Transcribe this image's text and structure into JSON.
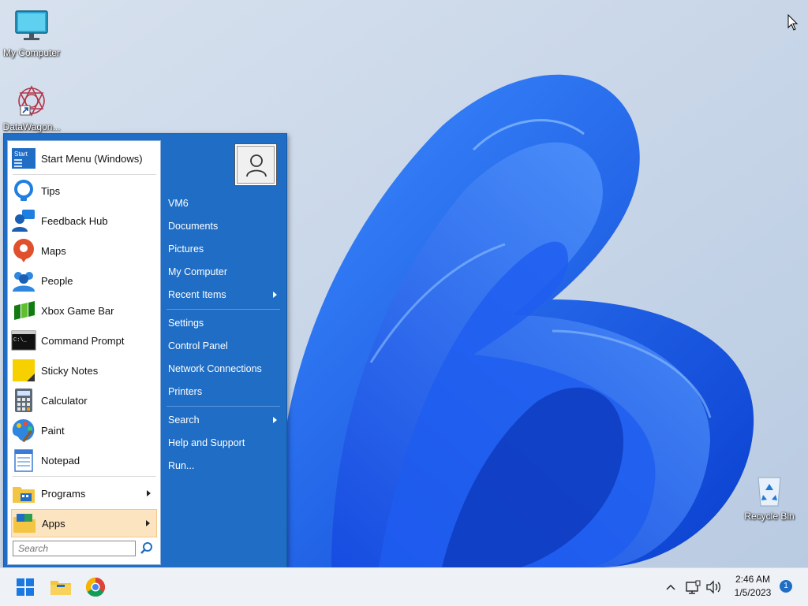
{
  "desktop": {
    "icons": [
      {
        "label": "My Computer"
      },
      {
        "label": "DataWagon..."
      },
      {
        "label": "Recycle Bin"
      }
    ]
  },
  "start_menu": {
    "header_item": {
      "label": "Start Menu (Windows)",
      "icon": "start-menu-icon"
    },
    "pinned": [
      {
        "label": "Tips",
        "icon": "tips-icon"
      },
      {
        "label": "Feedback Hub",
        "icon": "feedback-hub-icon"
      },
      {
        "label": "Maps",
        "icon": "maps-icon"
      },
      {
        "label": "People",
        "icon": "people-icon"
      },
      {
        "label": "Xbox Game Bar",
        "icon": "xbox-game-bar-icon"
      },
      {
        "label": "Command Prompt",
        "icon": "command-prompt-icon"
      },
      {
        "label": "Sticky Notes",
        "icon": "sticky-notes-icon"
      },
      {
        "label": "Calculator",
        "icon": "calculator-icon"
      },
      {
        "label": "Paint",
        "icon": "paint-icon"
      },
      {
        "label": "Notepad",
        "icon": "notepad-icon"
      }
    ],
    "programs": {
      "label": "Programs",
      "icon": "programs-icon"
    },
    "apps": {
      "label": "Apps",
      "icon": "apps-icon"
    },
    "search": {
      "placeholder": "Search"
    },
    "right": {
      "group1": [
        {
          "label": "VM6"
        },
        {
          "label": "Documents"
        },
        {
          "label": "Pictures"
        },
        {
          "label": "My Computer"
        },
        {
          "label": "Recent Items"
        }
      ],
      "group2": [
        {
          "label": "Settings"
        },
        {
          "label": "Control Panel"
        },
        {
          "label": "Network Connections"
        },
        {
          "label": "Printers"
        }
      ],
      "group3": [
        {
          "label": "Search"
        },
        {
          "label": "Help and Support"
        },
        {
          "label": "Run..."
        }
      ]
    }
  },
  "taskbar": {
    "time": "2:46 AM",
    "date": "1/5/2023",
    "notification_count": "1"
  },
  "colors": {
    "menu_blue": "#1f6dc4",
    "apps_highlight": "#fde4c0",
    "taskbar": "#eef1f6"
  }
}
